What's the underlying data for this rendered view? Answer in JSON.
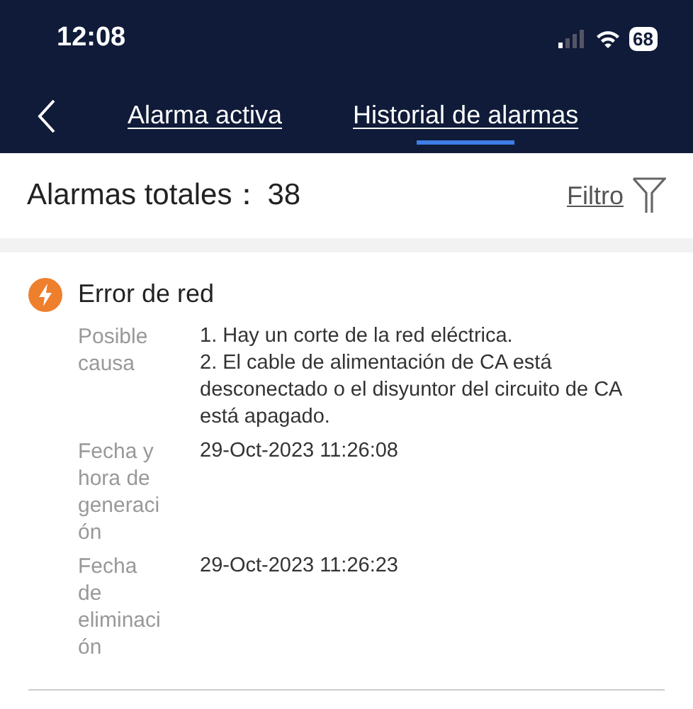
{
  "status_bar": {
    "time": "12:08",
    "battery": "68"
  },
  "tabs": [
    {
      "label": "Alarma activa",
      "selected": false
    },
    {
      "label": "Historial de alarmas",
      "selected": true
    }
  ],
  "summary": {
    "label": "Alarmas totales：",
    "count": "38",
    "filter": "Filtro"
  },
  "alarms": [
    {
      "title": "Error de red",
      "fields": [
        {
          "label": "Posible causa",
          "value": "1. Hay un corte de la red eléctrica.\n2. El cable de alimentación de CA está desconectado o el disyuntor del circuito de CA está apagado."
        },
        {
          "label": "Fecha y hora de generación",
          "value": "29-Oct-2023 11:26:08"
        },
        {
          "label": "Fecha de eliminación",
          "value": "29-Oct-2023 11:26:23"
        }
      ]
    }
  ]
}
